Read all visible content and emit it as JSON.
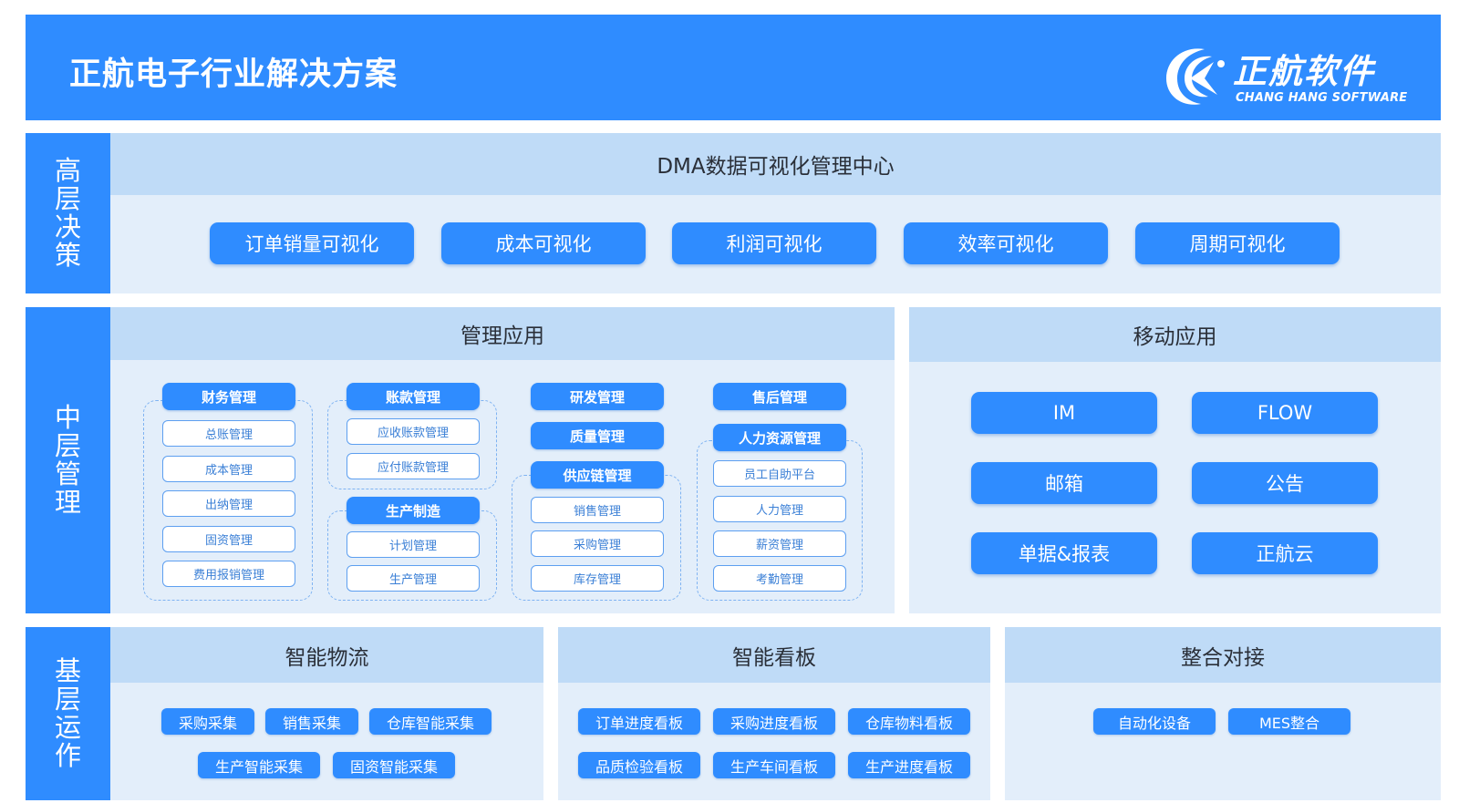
{
  "header": {
    "title": "正航电子行业解决方案",
    "logo_cn": "正航软件",
    "logo_en": "CHANG HANG SOFTWARE"
  },
  "colors": {
    "primary": "#2f8cff",
    "panel": "#e3eefa",
    "panel_header": "#bfdbf7"
  },
  "tiers": {
    "top": "高层决策",
    "middle": "中层管理",
    "bottom": "基层运作"
  },
  "dma": {
    "title": "DMA数据可视化管理中心",
    "items": [
      "订单销量可视化",
      "成本可视化",
      "利润可视化",
      "效率可视化",
      "周期可视化"
    ]
  },
  "management": {
    "title": "管理应用",
    "finance": {
      "title": "财务管理",
      "items": [
        "总账管理",
        "成本管理",
        "出纳管理",
        "固资管理",
        "费用报销管理"
      ]
    },
    "accounts": {
      "title": "账款管理",
      "items": [
        "应收账款管理",
        "应付账款管理"
      ]
    },
    "production": {
      "title": "生产制造",
      "items": [
        "计划管理",
        "生产管理"
      ]
    },
    "rd": {
      "title": "研发管理"
    },
    "quality": {
      "title": "质量管理"
    },
    "supply": {
      "title": "供应链管理",
      "items": [
        "销售管理",
        "采购管理",
        "库存管理"
      ]
    },
    "aftersales": {
      "title": "售后管理"
    },
    "hr": {
      "title": "人力资源管理",
      "items": [
        "员工自助平台",
        "人力管理",
        "薪资管理",
        "考勤管理"
      ]
    }
  },
  "mobile": {
    "title": "移动应用",
    "items": [
      "IM",
      "FLOW",
      "邮箱",
      "公告",
      "单据&报表",
      "正航云"
    ]
  },
  "logistics": {
    "title": "智能物流",
    "items": [
      "采购采集",
      "销售采集",
      "仓库智能采集",
      "生产智能采集",
      "固资智能采集"
    ]
  },
  "kanban": {
    "title": "智能看板",
    "items": [
      "订单进度看板",
      "采购进度看板",
      "仓库物料看板",
      "品质检验看板",
      "生产车间看板",
      "生产进度看板"
    ]
  },
  "integration": {
    "title": "整合对接",
    "items": [
      "自动化设备",
      "MES整合"
    ]
  }
}
